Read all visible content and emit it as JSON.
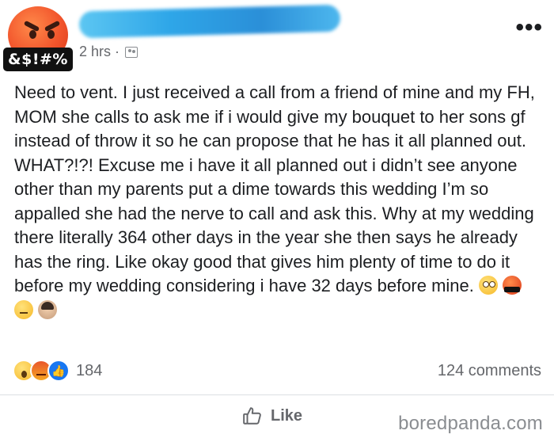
{
  "header": {
    "avatar_symbols": "&$!#%",
    "time": "2 hrs",
    "separator": "·",
    "audience_icon": "friends-icon",
    "more_label": "•••"
  },
  "post": {
    "text": "Need to vent. I just received a call from a friend of mine and my FH, MOM she calls to ask me if i would give my bouquet to her sons gf instead of throw it so he can propose that he has it all planned out. WHAT?!?! Excuse me i have it all planned out i didn’t see anyone other than my parents put a dime towards this wedding I’m so appalled she had the nerve to call and ask this. Why at my wedding there literally 364 other days in the year she then says he already has the ring. Like okay good that gives him plenty of time to do it before my wedding considering i have 32 days before mine.",
    "emojis": [
      "flushed-face-icon",
      "face-with-symbols-icon",
      "face-with-rolling-eyes-icon",
      "person-facepalming-icon"
    ]
  },
  "stats": {
    "reaction_icons": [
      "wow-icon",
      "angry-icon",
      "like-icon"
    ],
    "reaction_count": "184",
    "comments": "124 comments"
  },
  "actions": {
    "like_label": "Like"
  },
  "watermark": "boredpanda.com",
  "colors": {
    "name_blur": "#2ea6e8",
    "meta_text": "#65676b",
    "like_blue": "#1877f2",
    "angry_orange": "#e9562c"
  }
}
